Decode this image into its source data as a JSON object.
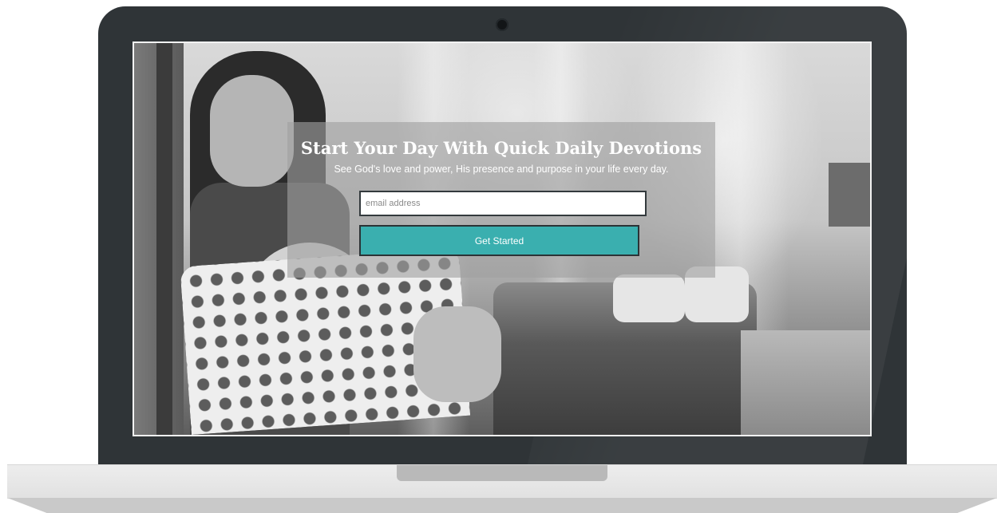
{
  "hero": {
    "headline": "Start Your Day With Quick Daily Devotions",
    "subheadline": "See God's love and power, His presence and purpose in your life every day.",
    "email_placeholder": "email address",
    "email_value": "",
    "cta_label": "Get Started"
  },
  "colors": {
    "cta_background": "#3aafaf",
    "cta_text": "#ffffff",
    "bezel": "#2f3437",
    "laptop_base": "#e6e6e6"
  },
  "icons": {
    "camera": "camera-icon"
  }
}
